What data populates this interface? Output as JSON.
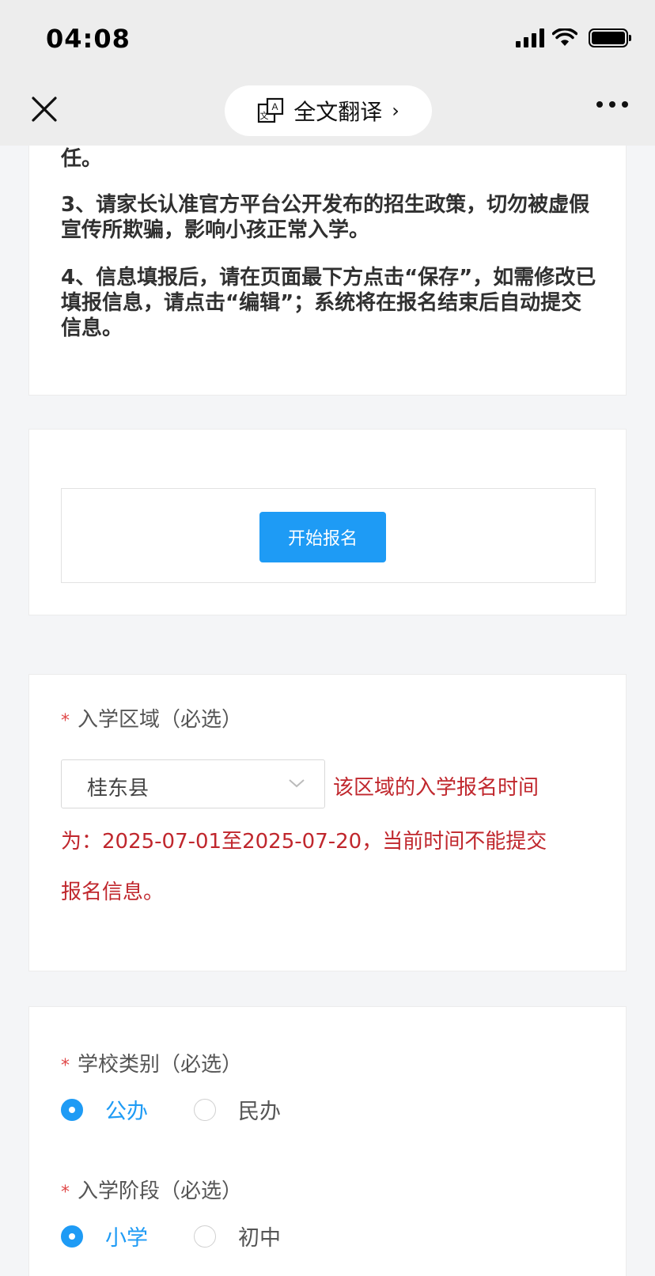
{
  "status_bar": {
    "time": "04:08"
  },
  "nav": {
    "translate_label": "全文翻译",
    "translate_chevron": "›"
  },
  "notice": {
    "line_tail": "任。",
    "item3": "3、请家长认准官方平台公开发布的招生政策，切勿被虚假宣传所欺骗，影响小孩正常入学。",
    "item4": "4、信息填报后，请在页面最下方点击“保存”，如需修改已填报信息，请点击“编辑”；系统将在报名结束后自动提交信息。"
  },
  "start": {
    "button_label": "开始报名"
  },
  "region": {
    "required_mark": "*",
    "label": "入学区域（必选）",
    "selected_value": "桂东县",
    "warning_line1": "该区域的入学报名时间",
    "warning_line2": "为：2025-07-01至2025-07-20，当前时间不能提交",
    "warning_line3": "报名信息。"
  },
  "school_type": {
    "required_mark": "*",
    "label": "学校类别（必选）",
    "options": [
      {
        "label": "公办",
        "selected": true
      },
      {
        "label": "民办",
        "selected": false
      }
    ]
  },
  "stage": {
    "required_mark": "*",
    "label": "入学阶段（必选）",
    "options": [
      {
        "label": "小学",
        "selected": true
      },
      {
        "label": "初中",
        "selected": false
      }
    ]
  },
  "colors": {
    "accent": "#1e9bf5",
    "warning": "#c0272d",
    "required": "#e04848"
  }
}
